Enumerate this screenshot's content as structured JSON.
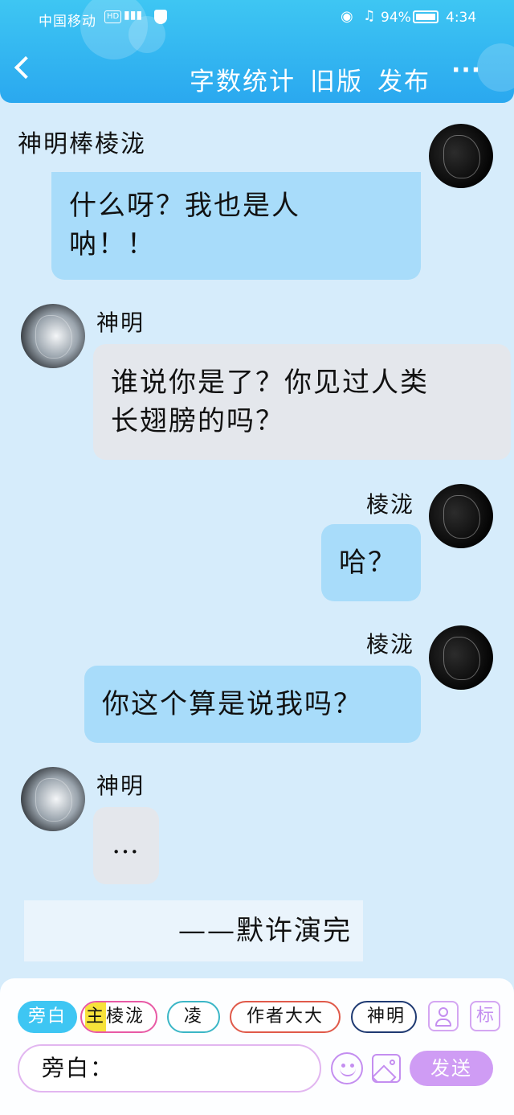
{
  "status_bar": {
    "carrier": "中国移动",
    "hd": "HD",
    "network": "4G",
    "battery_percent": "94%",
    "time": "4:34"
  },
  "nav": {
    "actions": [
      "字数统计",
      "旧版",
      "发布"
    ],
    "more": "···"
  },
  "chat": {
    "title": "神明棒棱泷",
    "messages": [
      {
        "side": "mine",
        "sender": "",
        "text_line1": "什么呀？我也是人",
        "text_line2": "呐！！"
      },
      {
        "side": "other",
        "sender": "神明",
        "text_line1": "谁说你是了？你见过人类",
        "text_line2": "长翅膀的吗？"
      },
      {
        "side": "mine",
        "sender": "棱泷",
        "text_line1": "哈？"
      },
      {
        "side": "mine",
        "sender": "棱泷",
        "text_line1": "你这个算是说我吗？"
      },
      {
        "side": "other",
        "sender": "神明",
        "text_line1": "…"
      }
    ],
    "narration": "——默许演完"
  },
  "bottom_bar": {
    "roles": {
      "narrator": "旁白",
      "main_tag": "主",
      "main_name": "棱泷",
      "ling": "凌",
      "author": "作者大大",
      "shenming": "神明"
    },
    "mark_icon": "标",
    "input_value": "旁白：",
    "send": "发送"
  },
  "colors": {
    "header": "#2aa8ef",
    "bubble_mine": "#a8dcfa",
    "bubble_other": "#e4e7ec",
    "accent_purple": "#cf9cf4"
  }
}
